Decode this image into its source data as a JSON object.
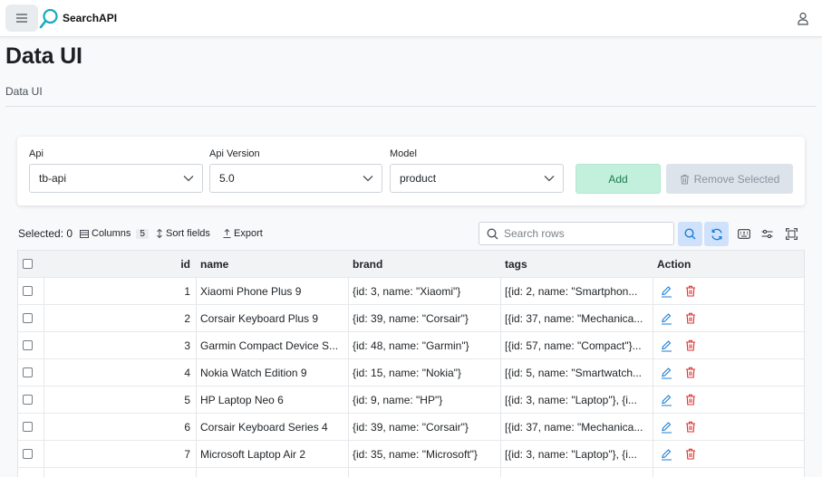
{
  "app": {
    "title": "SearchAPI"
  },
  "page": {
    "title": "Data UI",
    "breadcrumb": "Data UI"
  },
  "config": {
    "api": {
      "label": "Api",
      "value": "tb-api"
    },
    "api_version": {
      "label": "Api Version",
      "value": "5.0"
    },
    "model": {
      "label": "Model",
      "value": "product"
    },
    "add_label": "Add",
    "remove_label": "Remove Selected"
  },
  "toolbar": {
    "selected_label": "Selected: 0",
    "columns_label": "Columns",
    "columns_count": "5",
    "sort_label": "Sort fields",
    "export_label": "Export",
    "search_placeholder": "Search rows"
  },
  "table": {
    "headers": {
      "id": "id",
      "name": "name",
      "brand": "brand",
      "tags": "tags",
      "action": "Action"
    },
    "rows": [
      {
        "id": "1",
        "name": "Xiaomi Phone Plus 9",
        "brand": "{id: 3, name: \"Xiaomi\"}",
        "tags": "[{id: 2, name: \"Smartphon..."
      },
      {
        "id": "2",
        "name": "Corsair Keyboard Plus 9",
        "brand": "{id: 39, name: \"Corsair\"}",
        "tags": "[{id: 37, name: \"Mechanica..."
      },
      {
        "id": "3",
        "name": "Garmin Compact Device S...",
        "brand": "{id: 48, name: \"Garmin\"}",
        "tags": "[{id: 57, name: \"Compact\"}..."
      },
      {
        "id": "4",
        "name": "Nokia Watch Edition 9",
        "brand": "{id: 15, name: \"Nokia\"}",
        "tags": "[{id: 5, name: \"Smartwatch..."
      },
      {
        "id": "5",
        "name": "HP Laptop Neo 6",
        "brand": "{id: 9, name: \"HP\"}",
        "tags": "[{id: 3, name: \"Laptop\"}, {i..."
      },
      {
        "id": "6",
        "name": "Corsair Keyboard Series 4",
        "brand": "{id: 39, name: \"Corsair\"}",
        "tags": "[{id: 37, name: \"Mechanica..."
      },
      {
        "id": "7",
        "name": "Microsoft Laptop Air 2",
        "brand": "{id: 35, name: \"Microsoft\"}",
        "tags": "[{id: 3, name: \"Laptop\"}, {i..."
      }
    ]
  },
  "colors": {
    "accent": "#1c7ed6",
    "add_bg": "#c3f0dc",
    "delete": "#e03131",
    "logo": "#15aabf"
  },
  "icons": [
    "menu-icon",
    "search-logo-icon",
    "user-icon",
    "chevron-down-icon",
    "trash-icon",
    "columns-icon",
    "sort-icon",
    "export-icon",
    "search-icon",
    "refresh-icon",
    "keyboard-icon",
    "filter-icon",
    "fullscreen-icon",
    "edit-icon",
    "delete-icon"
  ]
}
